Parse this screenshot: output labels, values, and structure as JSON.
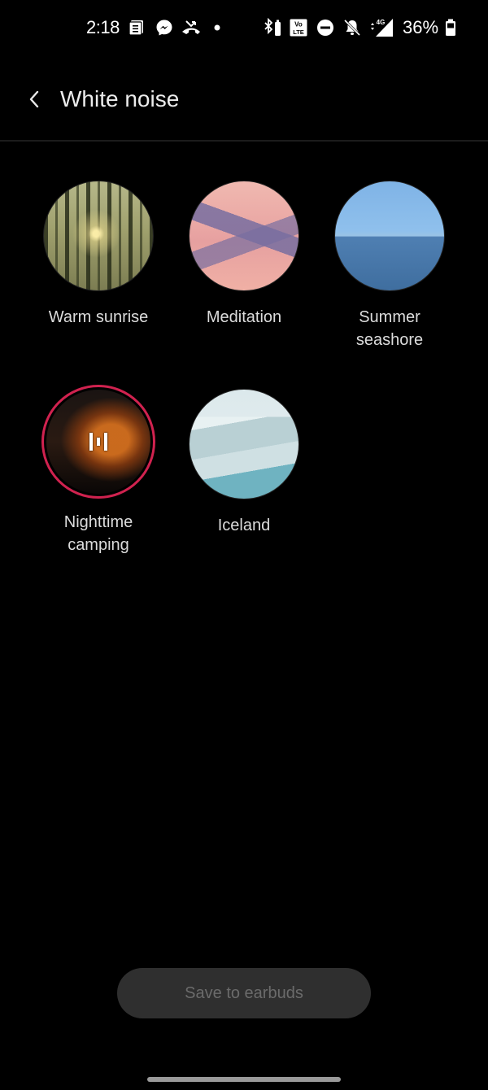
{
  "status_bar": {
    "time": "2:18",
    "left_icons": [
      "notes-icon",
      "messenger-icon",
      "missed-call-icon",
      "dot-icon"
    ],
    "right_icons": [
      "bluetooth-icon",
      "volte-icon",
      "do-not-disturb-icon",
      "bell-off-icon",
      "signal-4g-icon",
      "battery-icon"
    ],
    "volte_label": "VoLTE",
    "network_label": "4G",
    "battery_percent": "36%"
  },
  "header": {
    "title": "White noise",
    "back_icon": "chevron-left-icon"
  },
  "sounds": [
    {
      "label": "Warm sunrise",
      "image": "forest-sunrise",
      "selected": false
    },
    {
      "label": "Meditation",
      "image": "pink-mountain-lake",
      "selected": false
    },
    {
      "label": "Summer seashore",
      "label_line1": "Summer",
      "label_line2": "seashore",
      "image": "ocean-horizon",
      "selected": false
    },
    {
      "label": "Nighttime camping",
      "label_line1": "Nighttime",
      "label_line2": "camping",
      "image": "tent-at-night",
      "selected": true,
      "playing": true
    },
    {
      "label": "Iceland",
      "image": "snowy-mountains",
      "selected": false
    }
  ],
  "accent_color": "#d0224f",
  "save_button": {
    "label": "Save to earbuds",
    "enabled": false
  }
}
